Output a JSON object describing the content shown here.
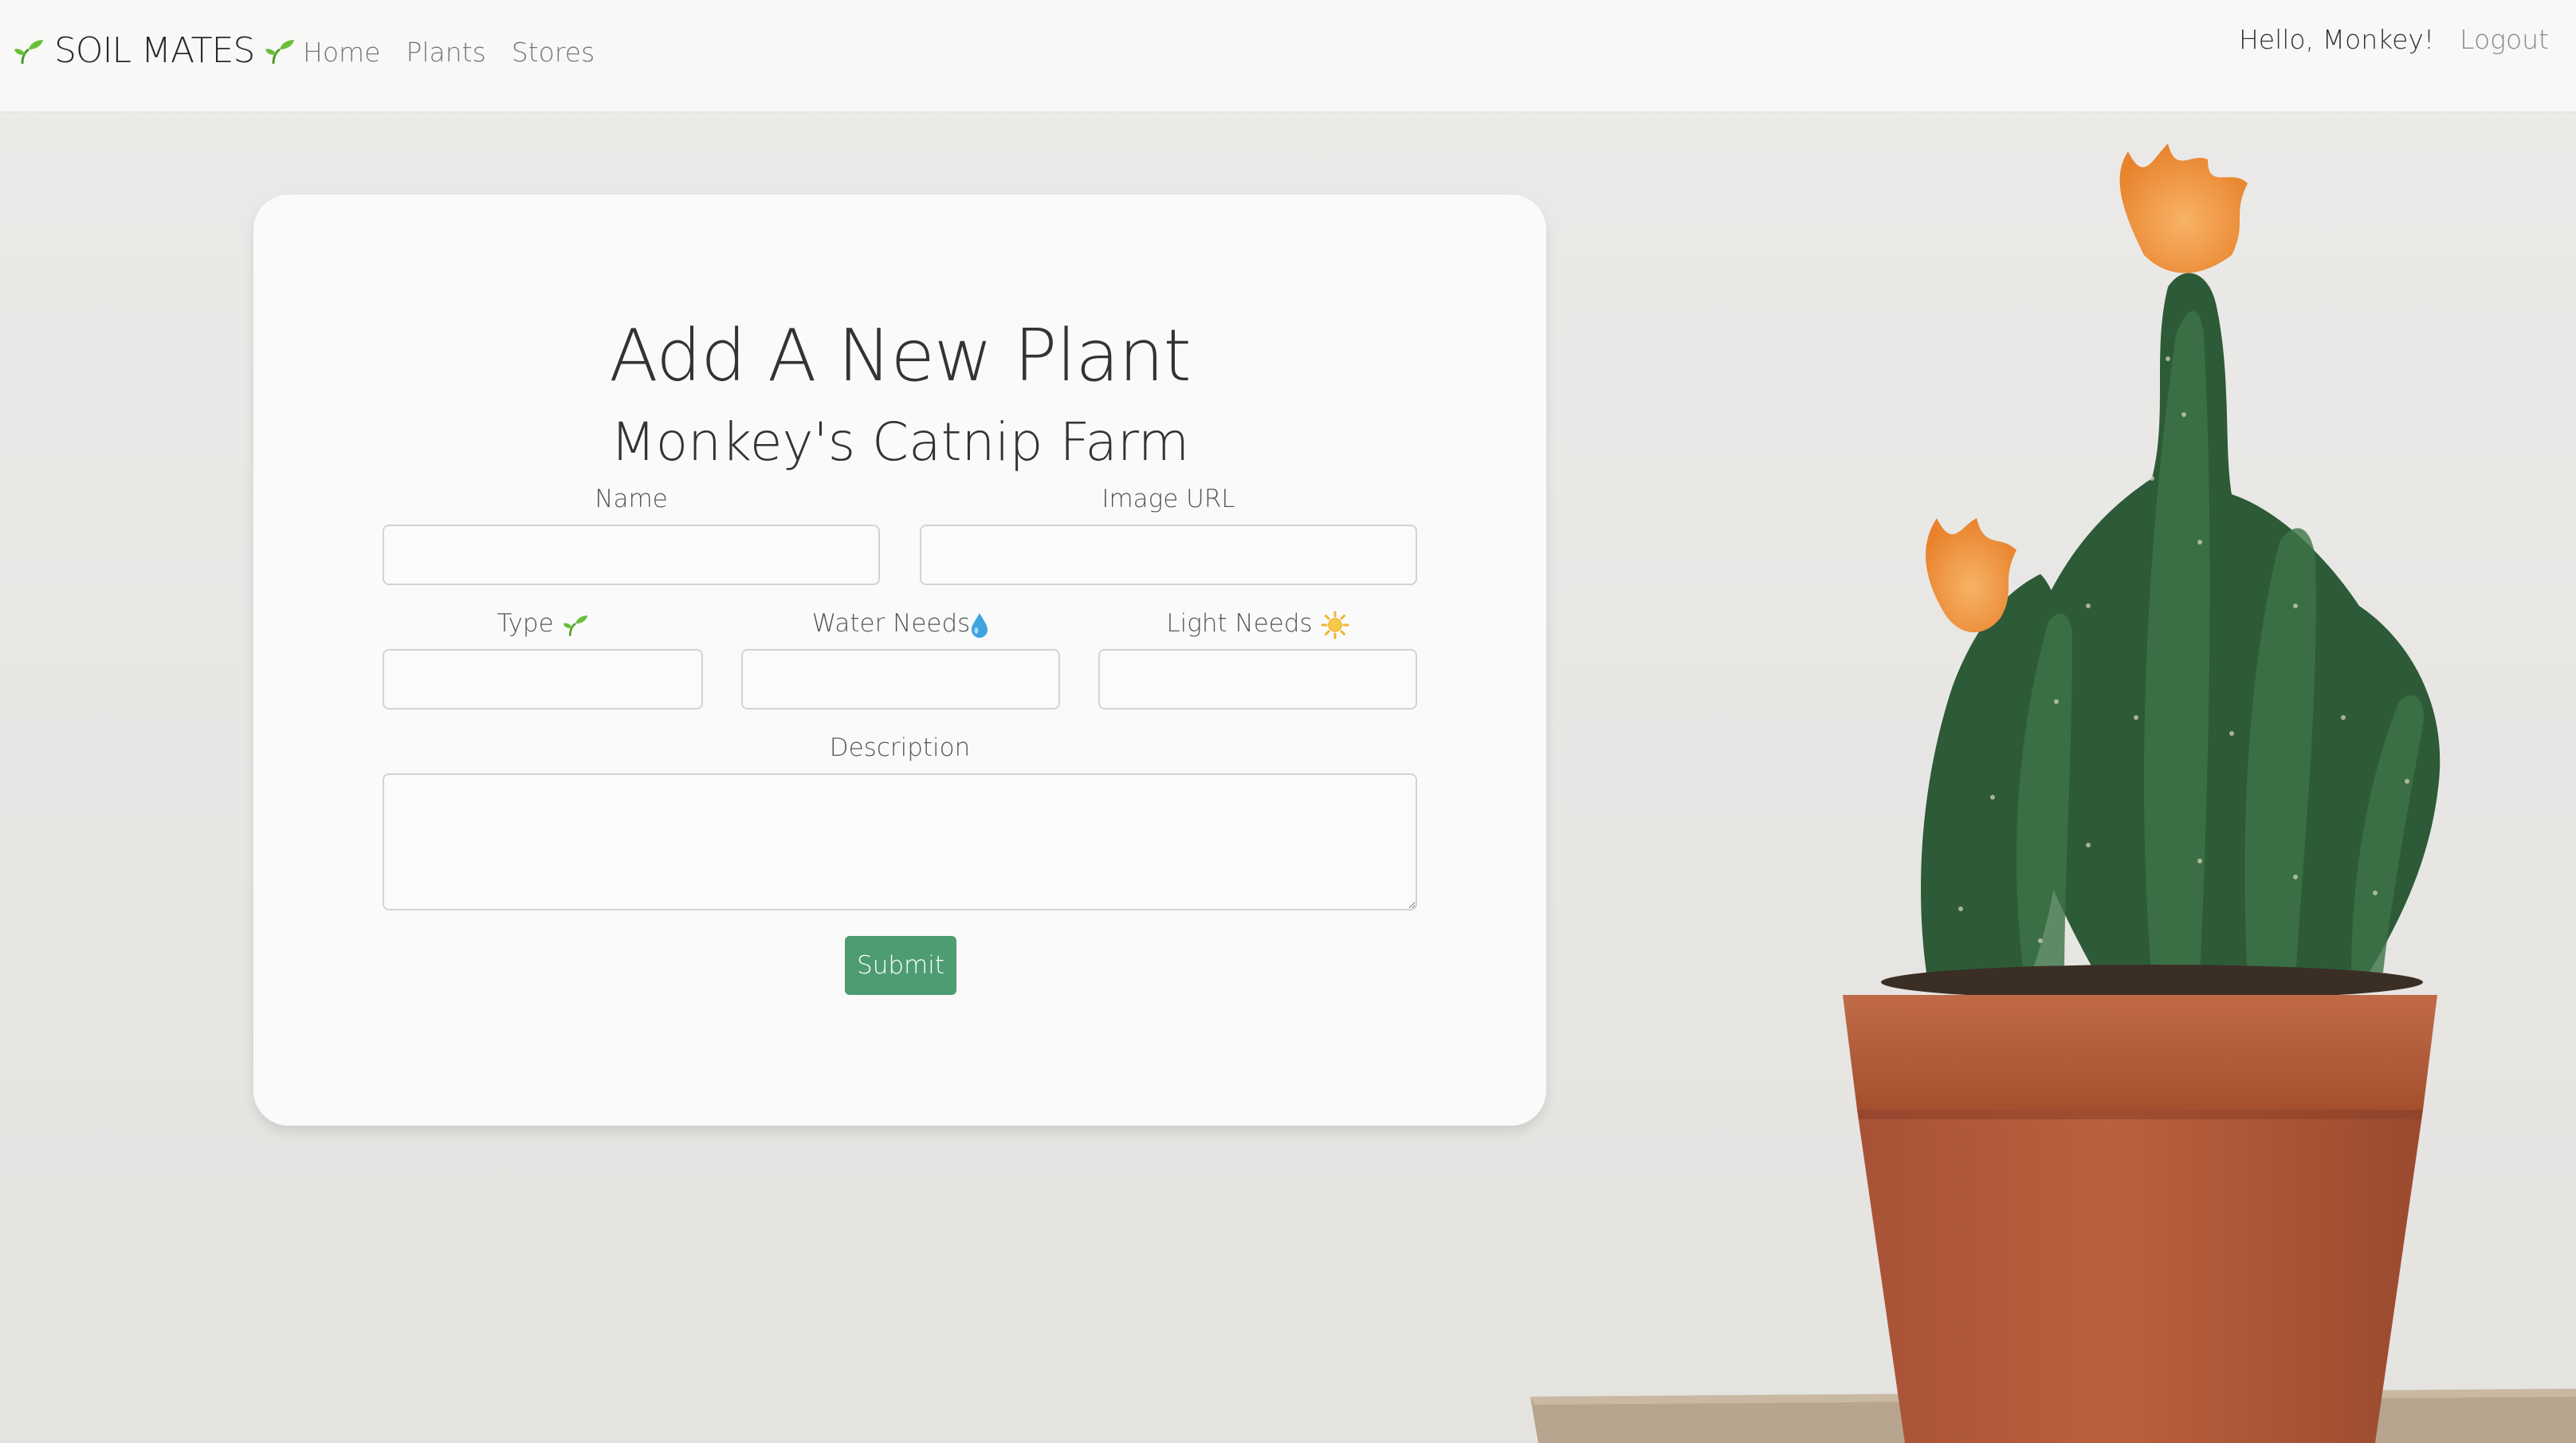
{
  "navbar": {
    "brand": "SOIL MATES",
    "links": [
      "Home",
      "Plants",
      "Stores"
    ],
    "greeting": "Hello, Monkey!",
    "logout": "Logout"
  },
  "form": {
    "title": "Add A New Plant",
    "subtitle": "Monkey's Catnip Farm",
    "fields": {
      "name": {
        "label": "Name",
        "value": ""
      },
      "image_url": {
        "label": "Image URL",
        "value": ""
      },
      "type": {
        "label": "Type",
        "value": "",
        "icon": "sprout-icon"
      },
      "water_needs": {
        "label": "Water Needs",
        "value": "",
        "icon": "water-drop-icon"
      },
      "light_needs": {
        "label": "Light Needs",
        "value": "",
        "icon": "sun-icon"
      },
      "description": {
        "label": "Description",
        "value": ""
      }
    },
    "submit_label": "Submit"
  },
  "colors": {
    "accent": "#4e9c72",
    "sprout": "#6abf3a",
    "pot": "#b25a3a",
    "flower": "#f29a4a"
  }
}
